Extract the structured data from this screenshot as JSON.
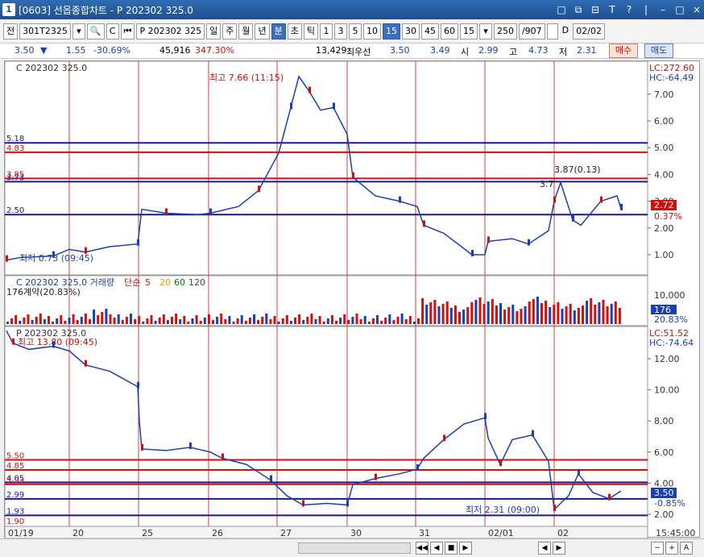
{
  "window": {
    "title": "[0603] 선옵종합차트 - P 202302 325.0",
    "app_icon": "1",
    "controls": [
      "□",
      "⧉",
      "⊟",
      "T",
      "?",
      "|",
      "–",
      "□",
      "×"
    ]
  },
  "toolbar": {
    "items": [
      "전",
      "301T2325",
      "▾",
      "🔍",
      "C",
      "⏮",
      "P 202302 325",
      "일",
      "주",
      "월",
      "년",
      "분",
      "초",
      "틱",
      "1",
      "3",
      "5",
      "10",
      "15",
      "30",
      "45",
      "60",
      "15",
      "▾",
      "250",
      "/907"
    ],
    "selected": [
      "분",
      "15"
    ],
    "date": "02/02",
    "date_prefix": "D"
  },
  "quote": {
    "price": "3.50",
    "arrow": "▼",
    "change": "1.55",
    "change_pct": "-30.69%",
    "volume": "45,916",
    "volume_pct": "347.30%",
    "open_interest": "13,429",
    "best_label": "최우선",
    "best_ask": "3.50",
    "best_bid": "3.49",
    "open_label": "시",
    "open": "2.99",
    "high_label": "고",
    "high": "4.73",
    "low_label": "저",
    "low": "2.31",
    "buy_label": "매수",
    "sell_label": "매도"
  },
  "panels": {
    "call": {
      "title": "C 202302 325.0",
      "lc": "LC:272.60",
      "hc": "HC:-64.49",
      "yticks": [
        "7.00",
        "6.00",
        "5.00",
        "4.00",
        "3.00",
        "2.00",
        "1.00"
      ],
      "hlines": [
        {
          "label": "5.18",
          "color": "#1a1a8c"
        },
        {
          "label": "4.83",
          "color": "#d01010"
        },
        {
          "label": "3.85",
          "color": "#d01010"
        },
        {
          "label": "3.73",
          "color": "#1a1a8c"
        },
        {
          "label": "2.50",
          "color": "#1a1a8c"
        }
      ],
      "high_note": "최고 7.66 (11:15)",
      "low_note": "최저 0.73 (09:45)",
      "note2": "3.87(0.13)",
      "note3": "3.7",
      "current": "2.72",
      "current_pct": "0.37%"
    },
    "volume": {
      "title": "C 202302 325.0 거래량",
      "legend": [
        "단순",
        "5",
        "20",
        "60",
        "120"
      ],
      "legend_colors": [
        "#d01010",
        "#d01010",
        "#e0a000",
        "#008000",
        "#444"
      ],
      "note": "176계약(20.83%)",
      "ytick": "10,000",
      "current": "176",
      "current_pct": "20.83%"
    },
    "put": {
      "title": "P 202302 325.0",
      "lc": "LC:51.52",
      "hc": "HC:-74.64",
      "yticks": [
        "12.00",
        "10.00",
        "8.00",
        "6.00",
        "4.00",
        "2.00"
      ],
      "hlines": [
        {
          "label": "5.50",
          "color": "#d01010"
        },
        {
          "label": "4.85",
          "color": "#d01010"
        },
        {
          "label": "4.05",
          "color": "#1a1a8c"
        },
        {
          "label": "3.93",
          "color": "#d01010"
        },
        {
          "label": "2.99",
          "color": "#1a1a8c"
        },
        {
          "label": "1.93",
          "color": "#1a1a8c"
        }
      ],
      "extra_labels": [
        "1.90"
      ],
      "high_note": "최고 13.80 (09:45)",
      "low_note": "최저 2.31 (09:00)",
      "current": "3.50",
      "current_pct": "-0.85%"
    }
  },
  "xaxis": {
    "labels": [
      "01/19",
      "20",
      "25",
      "26",
      "27",
      "30",
      "31",
      "02/01",
      "02"
    ],
    "time": "15:45:00"
  },
  "bottom": {
    "nav": [
      "◀◀",
      "◀",
      "■",
      "▶",
      "◀",
      "▶"
    ],
    "zoom": [
      "−",
      "+",
      "A"
    ]
  },
  "colors": {
    "up": "#d01010",
    "down": "#1c3fb0",
    "accent": "#3a6fc4"
  }
}
